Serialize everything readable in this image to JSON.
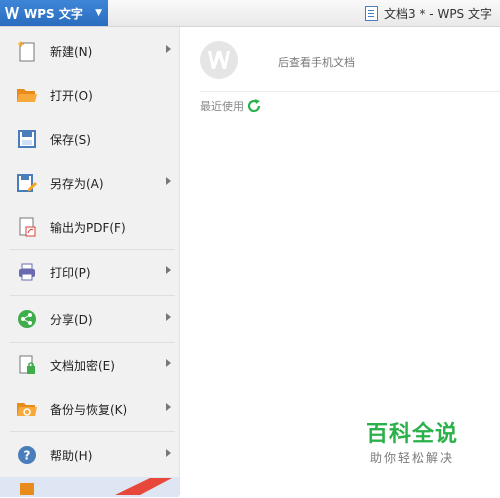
{
  "titlebar": {
    "app_name": "WPS 文字",
    "doc_title": "文档3 * - WPS 文字"
  },
  "menu": {
    "items": [
      {
        "label": "新建(N)",
        "icon": "new-doc-icon",
        "submenu": true
      },
      {
        "label": "打开(O)",
        "icon": "open-folder-icon",
        "submenu": false
      },
      {
        "label": "保存(S)",
        "icon": "save-icon",
        "submenu": false
      },
      {
        "label": "另存为(A)",
        "icon": "save-as-icon",
        "submenu": true
      },
      {
        "label": "输出为PDF(F)",
        "icon": "pdf-export-icon",
        "submenu": false
      },
      {
        "label": "打印(P)",
        "icon": "print-icon",
        "submenu": true
      },
      {
        "label": "分享(D)",
        "icon": "share-icon",
        "submenu": true
      },
      {
        "label": "文档加密(E)",
        "icon": "encrypt-icon",
        "submenu": true
      },
      {
        "label": "备份与恢复(K)",
        "icon": "backup-icon",
        "submenu": true
      },
      {
        "label": "帮助(H)",
        "icon": "help-icon",
        "submenu": true
      }
    ]
  },
  "right": {
    "phone_link": "后查看手机文档",
    "recent_label": "最近使用"
  },
  "watermark": {
    "line1": "百科全说",
    "line2": "助你轻松解决"
  }
}
